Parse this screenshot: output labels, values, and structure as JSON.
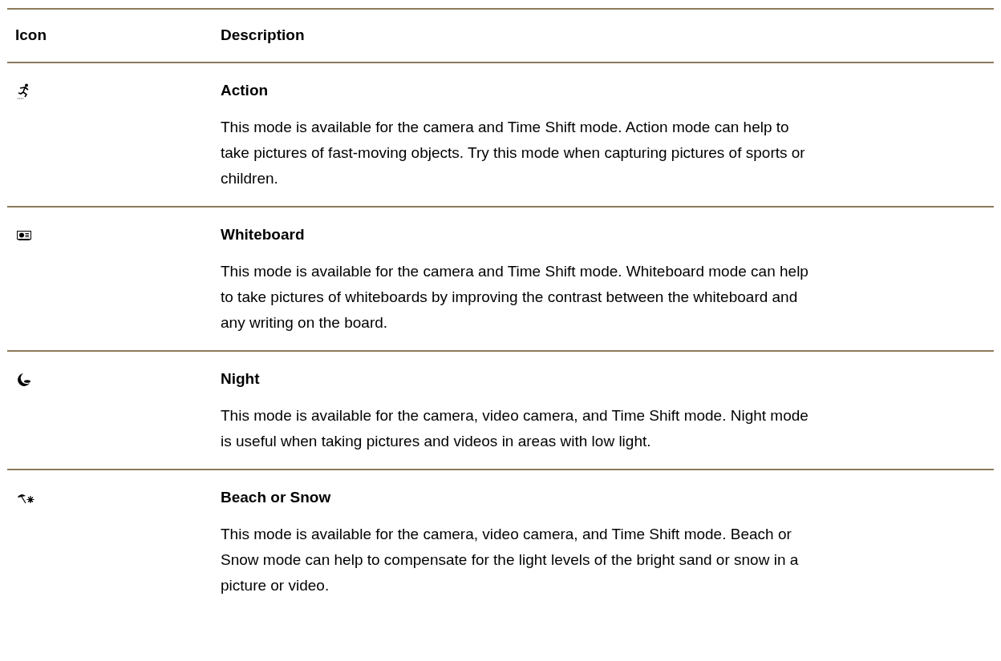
{
  "table": {
    "columns": [
      "Icon",
      "Description"
    ],
    "rows": [
      {
        "kind": "action",
        "title": "Action",
        "text": "This mode is available for the camera and Time Shift mode. Action mode can help to take pictures of fast-moving objects. Try this mode when capturing pictures of sports or children."
      },
      {
        "kind": "whiteboard",
        "title": "Whiteboard",
        "text": "This mode is available for the camera and Time Shift mode. Whiteboard mode can help to take pictures of whiteboards by improving the contrast between the whiteboard and any writing on the board."
      },
      {
        "kind": "night",
        "title": "Night",
        "text": "This mode is available for the camera, video camera, and Time Shift mode. Night mode is useful when taking pictures and videos in areas with low light."
      },
      {
        "kind": "beach_snow",
        "title": "Beach or Snow",
        "text": "This mode is available for the camera, video camera, and Time Shift mode. Beach or Snow mode can help to compensate for the light levels of the bright sand or snow in a picture or video."
      }
    ]
  }
}
